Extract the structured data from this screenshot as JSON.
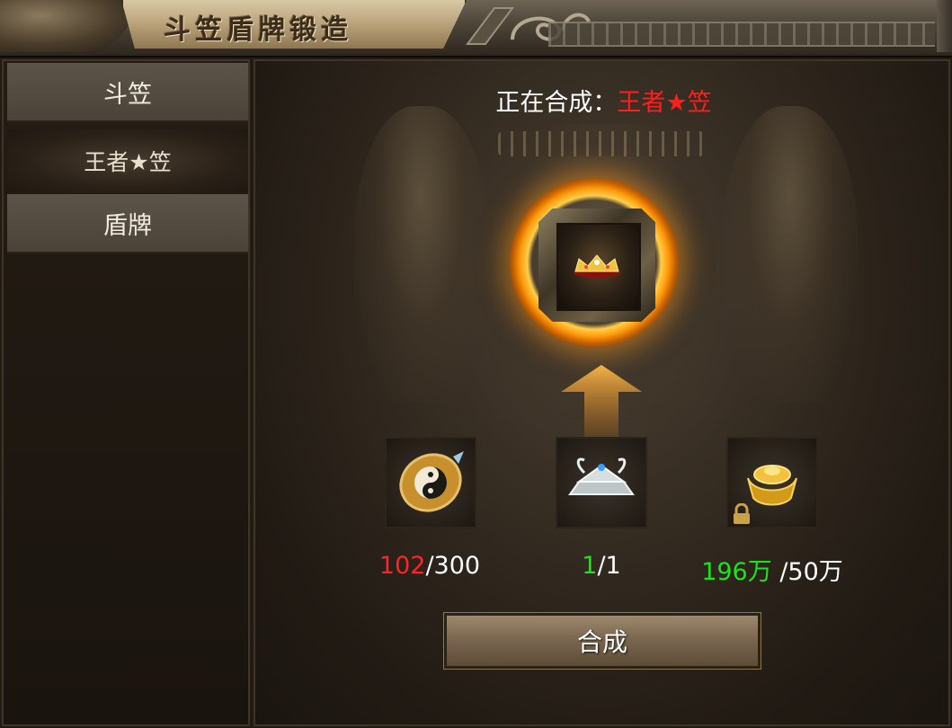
{
  "window": {
    "title": "斗笠盾牌锻造"
  },
  "sidebar": {
    "items": [
      {
        "label": "斗笠",
        "kind": "category",
        "selected": false
      },
      {
        "label": "王者★笠",
        "kind": "item",
        "selected": true
      },
      {
        "label": "盾牌",
        "kind": "category",
        "selected": false
      }
    ]
  },
  "main": {
    "synth_label": "正在合成：",
    "synth_target": "王者★笠",
    "target_icon": "crown-helmet-icon",
    "materials": [
      {
        "icon": "yinyang-talisman-icon",
        "have": "102",
        "need": "/300",
        "have_color": "#ff2424"
      },
      {
        "icon": "silver-hat-icon",
        "have": "1",
        "need": "/1",
        "have_color": "#19e619"
      },
      {
        "icon": "gold-ingot-icon",
        "have": "196万",
        "need": " /50万",
        "have_color": "#19e619",
        "locked": true
      }
    ],
    "forge_button": "合成"
  },
  "colors": {
    "highlight_red": "#ff1e1e",
    "ok_green": "#19e619",
    "ring_gold": "#ff9a0c"
  }
}
